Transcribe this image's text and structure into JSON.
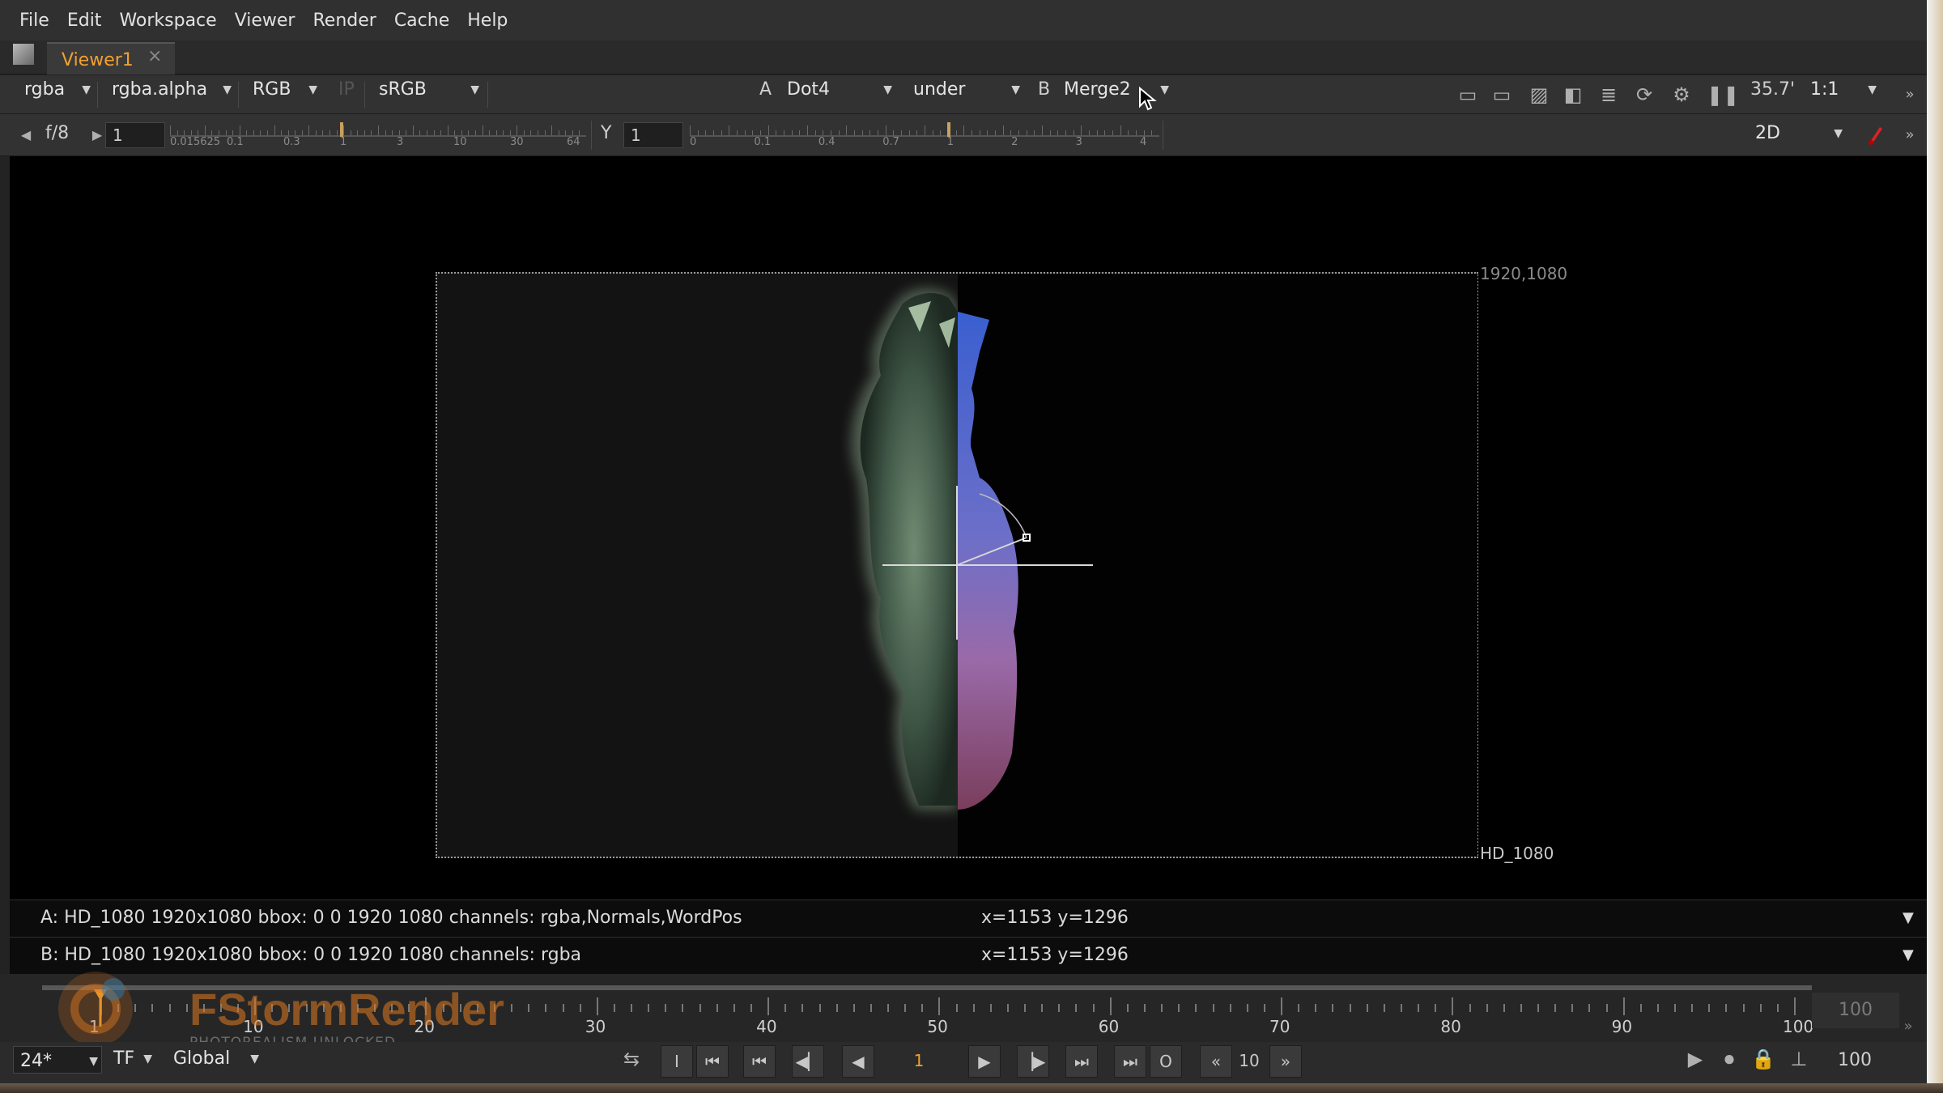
{
  "menu": [
    "File",
    "Edit",
    "Workspace",
    "Viewer",
    "Render",
    "Cache",
    "Help"
  ],
  "tab": {
    "label": "Viewer1",
    "close": "×"
  },
  "toolbar1": {
    "layer": "rgba",
    "channel": "rgba.alpha",
    "display": "RGB",
    "ip": "IP",
    "lut": "sRGB",
    "a_label": "A",
    "a_input": "Dot4",
    "wipe_mode": "under",
    "b_label": "B",
    "b_input": "Merge2",
    "zoom": "35.7'",
    "ratio": "1:1"
  },
  "toolbar2": {
    "fstop": "f/8",
    "gain_value": "1",
    "gain_ticks": [
      "0.015625",
      "0.1",
      "0.3",
      "1",
      "3",
      "10",
      "30",
      "64"
    ],
    "gamma_label": "Y",
    "gamma_value": "1",
    "gamma_ticks": [
      "0",
      "0.1",
      "0.4",
      "0.7",
      "1",
      "2",
      "3",
      "4"
    ],
    "view_mode": "2D"
  },
  "viewer": {
    "top_right_label": "1920,1080",
    "bottom_right_label": "HD_1080"
  },
  "info": {
    "a": "A:  HD_1080 1920x1080  bbox: 0 0 1920 1080 channels: rgba,Normals,WordPos",
    "a_xy": "x=1153 y=1296",
    "b": "B:  HD_1080 1920x1080  bbox: 0 0 1920 1080 channels: rgba",
    "b_xy": "x=1153 y=1296"
  },
  "timeline": {
    "labels": [
      "1",
      "10",
      "20",
      "30",
      "40",
      "50",
      "60",
      "70",
      "80",
      "90",
      "100"
    ],
    "end_frame": "100",
    "current_frame": 1
  },
  "playbar": {
    "fps": "24*",
    "tf": "TF",
    "scope": "Global",
    "frame": "1",
    "increment": "10",
    "last_frame": "100"
  },
  "watermark": {
    "brand": "FStormRender",
    "tagline": "PHOTOREALISM UNLOCKED"
  },
  "colors": {
    "accent_orange": "#f0a030",
    "bg": "#232323",
    "viewer_bg": "#000000"
  }
}
